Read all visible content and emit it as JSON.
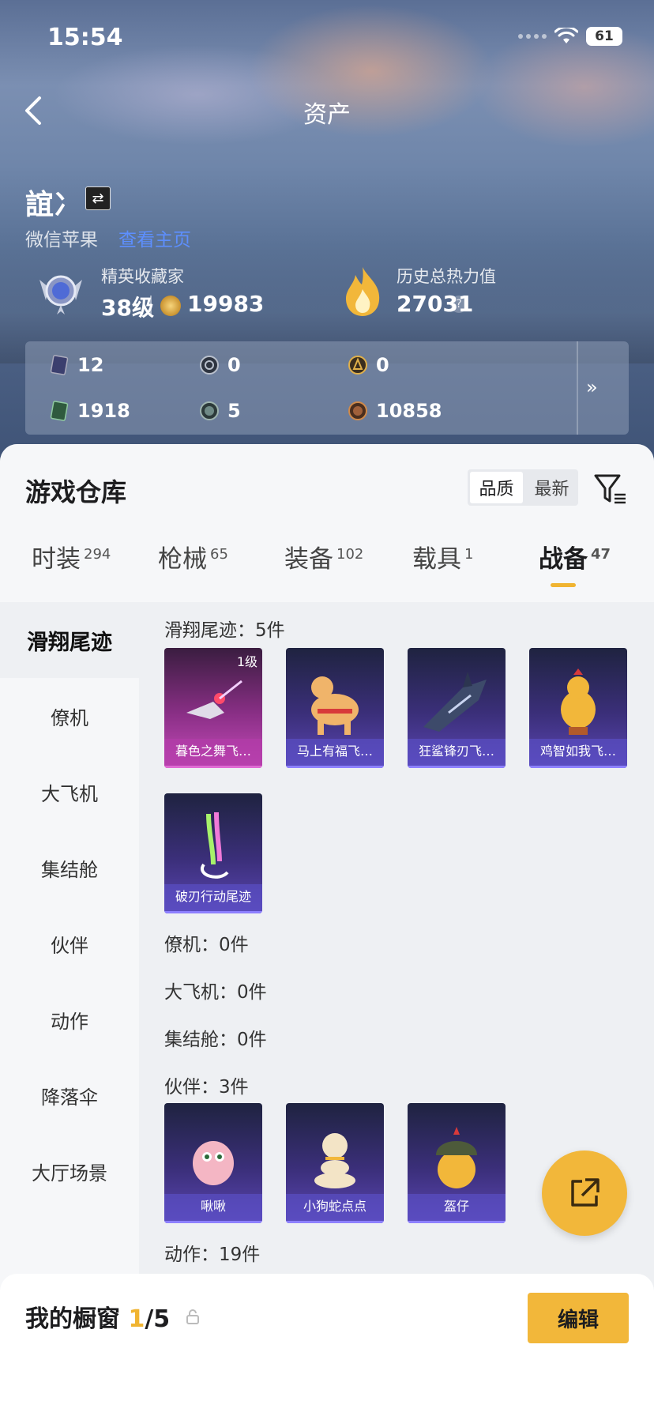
{
  "status": {
    "time": "15:54",
    "battery": "61"
  },
  "header": {
    "title": "资产"
  },
  "profile": {
    "name": "誼冫",
    "platform": "微信苹果",
    "platform_link": "查看主页",
    "rank_title": "精英收藏家",
    "rank_level": "38级",
    "collection_points": "19983",
    "heat_label": "历史总热力值",
    "heat_value": "27031",
    "help_symbol": "?"
  },
  "stats": {
    "row1": [
      {
        "icon": "card-icon",
        "value": "12"
      },
      {
        "icon": "silver-token-icon",
        "value": "0"
      },
      {
        "icon": "gold-token-icon",
        "value": "0"
      }
    ],
    "row2": [
      {
        "icon": "green-card-icon",
        "value": "1918"
      },
      {
        "icon": "gear-coin-icon",
        "value": "5"
      },
      {
        "icon": "bronze-coin-icon",
        "value": "10858"
      }
    ],
    "more": "»"
  },
  "warehouse": {
    "title": "游戏仓库",
    "sort": {
      "quality": "品质",
      "newest": "最新"
    },
    "tabs": [
      {
        "label": "时装",
        "count": "294"
      },
      {
        "label": "枪械",
        "count": "65"
      },
      {
        "label": "装备",
        "count": "102"
      },
      {
        "label": "载具",
        "count": "1"
      },
      {
        "label": "战备",
        "count": "47"
      }
    ]
  },
  "categories": [
    "滑翔尾迹",
    "僚机",
    "大飞机",
    "集结舱",
    "伙伴",
    "动作",
    "降落伞",
    "大厅场景"
  ],
  "sections": {
    "glide_trail": "滑翔尾迹：5件",
    "wingman": "僚机：0件",
    "big_plane": "大飞机：0件",
    "rally_pod": "集结舱：0件",
    "companion": "伙伴：3件",
    "action": "动作：19件"
  },
  "glide_items": [
    {
      "name": "暮色之舞飞…",
      "level": "1级"
    },
    {
      "name": "马上有福飞…"
    },
    {
      "name": "狂鲨锋刃飞…"
    },
    {
      "name": "鸡智如我飞…"
    },
    {
      "name": "破刃行动尾迹"
    }
  ],
  "companion_items": [
    {
      "name": "啾啾"
    },
    {
      "name": "小狗蛇点点"
    },
    {
      "name": "盔仔"
    }
  ],
  "showcase": {
    "label": "我的橱窗",
    "current": "1",
    "total": "/5",
    "edit": "编辑"
  },
  "colors": {
    "accent": "#f2b73a",
    "link": "#5d8fff"
  }
}
